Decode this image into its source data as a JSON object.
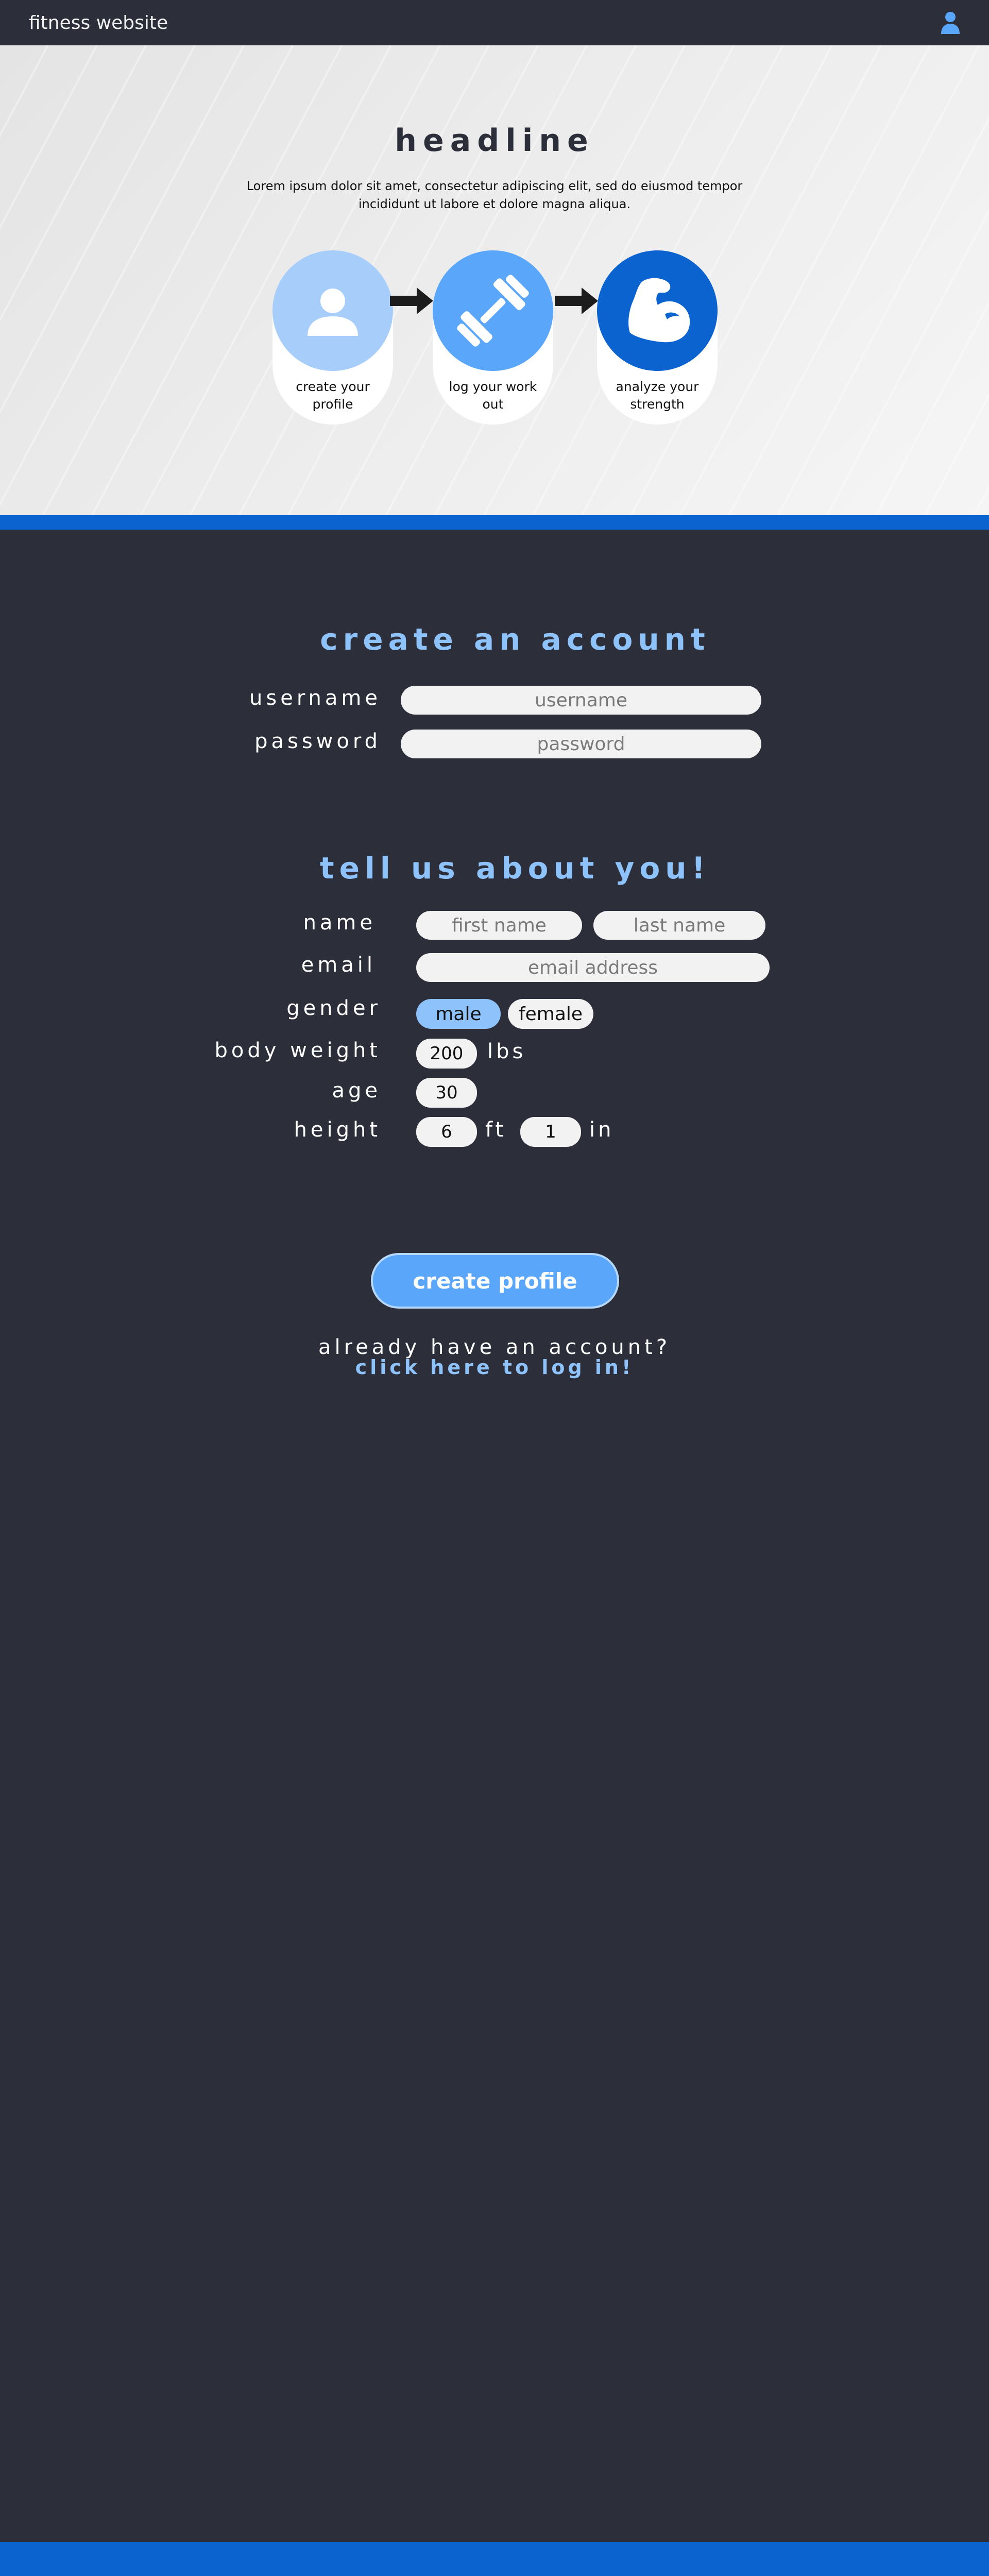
{
  "app": {
    "brand": "fitness website"
  },
  "colors": {
    "background": "#2c2e3a",
    "accent": "#0b63cf",
    "light_blue": "#8dc2fa",
    "button_blue": "#5aa6fb",
    "field": "#f2f2f2"
  },
  "hero": {
    "title": "headline",
    "description": "Lorem ipsum dolor sit amet, consectetur adipiscing elit, sed do eiusmod tempor incididunt ut labore et dolore magna aliqua.",
    "steps": [
      {
        "label": "create your profile",
        "icon": "user-icon",
        "color": "#a7cdfb"
      },
      {
        "label": "log your work out",
        "icon": "dumbbell-icon",
        "color": "#5aa6fb"
      },
      {
        "label": "analyze your strength",
        "icon": "flexed-bicep-icon",
        "color": "#0b63cf"
      }
    ]
  },
  "account": {
    "title": "create an account",
    "username_label": "username",
    "username_placeholder": "username",
    "password_label": "password",
    "password_placeholder": "password"
  },
  "about": {
    "title": "tell us about you!",
    "name_label": "name",
    "first_name_placeholder": "first name",
    "last_name_placeholder": "last name",
    "email_label": "email",
    "email_placeholder": "email address",
    "gender_label": "gender",
    "gender_options": [
      "male",
      "female"
    ],
    "gender_selected": "male",
    "weight_label": "body weight",
    "weight_value": "200",
    "weight_unit": "lbs",
    "age_label": "age",
    "age_value": "30",
    "height_label": "height",
    "height_ft_value": "6",
    "height_ft_unit": "ft",
    "height_in_value": "1",
    "height_in_unit": "in"
  },
  "cta": {
    "create_profile_label": "create profile",
    "login_question": "already have an account?",
    "login_link": "click here to log in!"
  }
}
